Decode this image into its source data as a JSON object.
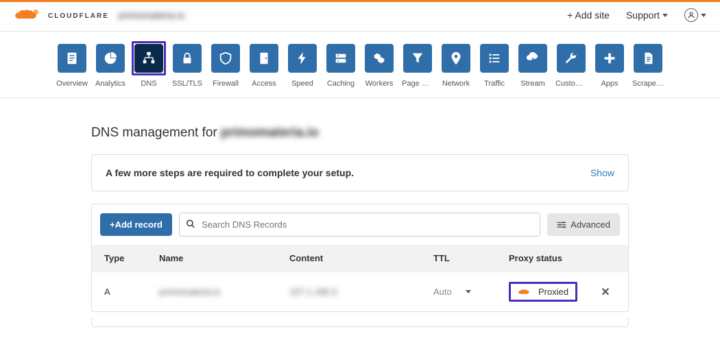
{
  "brand": "CLOUDFLARE",
  "header_domain": "primomateria.io",
  "header": {
    "add_site": "+ Add site",
    "support": "Support"
  },
  "nav": [
    {
      "label": "Overview",
      "icon": "clipboard"
    },
    {
      "label": "Analytics",
      "icon": "pie"
    },
    {
      "label": "DNS",
      "icon": "tree",
      "active": true,
      "highlight": true
    },
    {
      "label": "SSL/TLS",
      "icon": "lock"
    },
    {
      "label": "Firewall",
      "icon": "shield"
    },
    {
      "label": "Access",
      "icon": "door"
    },
    {
      "label": "Speed",
      "icon": "bolt"
    },
    {
      "label": "Caching",
      "icon": "drive"
    },
    {
      "label": "Workers",
      "icon": "hex"
    },
    {
      "label": "Page Rules",
      "icon": "funnel"
    },
    {
      "label": "Network",
      "icon": "pin"
    },
    {
      "label": "Traffic",
      "icon": "list"
    },
    {
      "label": "Stream",
      "icon": "cloud-down"
    },
    {
      "label": "Custom P…",
      "icon": "wrench"
    },
    {
      "label": "Apps",
      "icon": "plus"
    },
    {
      "label": "Scrape S…",
      "icon": "doc"
    }
  ],
  "page": {
    "title_prefix": "DNS management for ",
    "title_domain": "primomateria.io"
  },
  "alert": {
    "text": "A few more steps are required to complete your setup.",
    "link": "Show"
  },
  "controls": {
    "add_record": "+Add record",
    "search_placeholder": "Search DNS Records",
    "advanced": "Advanced"
  },
  "table": {
    "headers": {
      "type": "Type",
      "name": "Name",
      "content": "Content",
      "ttl": "TTL",
      "proxy": "Proxy status"
    },
    "rows": [
      {
        "type": "A",
        "name": "primomateria.io",
        "content": "157.1.186.3",
        "ttl": "Auto",
        "proxy": "Proxied"
      }
    ]
  }
}
